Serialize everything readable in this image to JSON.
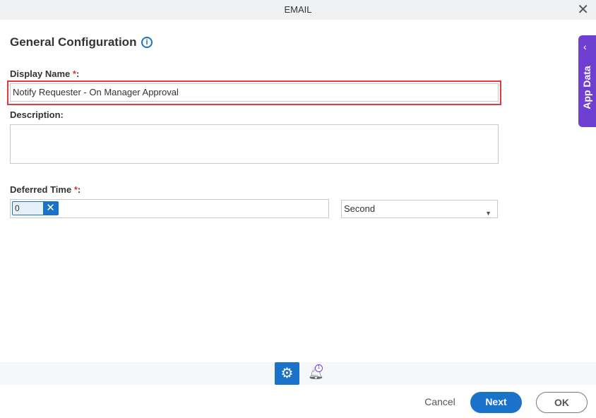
{
  "dialog": {
    "title": "EMAIL",
    "close_icon": "close-icon"
  },
  "section": {
    "title": "General Configuration",
    "info_icon": "info-icon"
  },
  "display_name": {
    "label": "Display Name",
    "required": "*",
    "colon": ":",
    "value": "Notify Requester - On Manager Approval"
  },
  "description": {
    "label": "Description:",
    "value": ""
  },
  "deferred_time": {
    "label": "Deferred Time",
    "required": "*",
    "colon": ":",
    "value": "0",
    "unit": "Second"
  },
  "app_data": {
    "label": "App Data",
    "color": "#6f3fd1"
  },
  "tabs": [
    {
      "icon": "gear-icon",
      "active": true
    },
    {
      "icon": "bell-icon",
      "badge": "1"
    }
  ],
  "footer": {
    "cancel": "Cancel",
    "next": "Next",
    "ok": "OK"
  },
  "colors": {
    "accent": "#1a73c8",
    "highlight": "#e8393a"
  }
}
